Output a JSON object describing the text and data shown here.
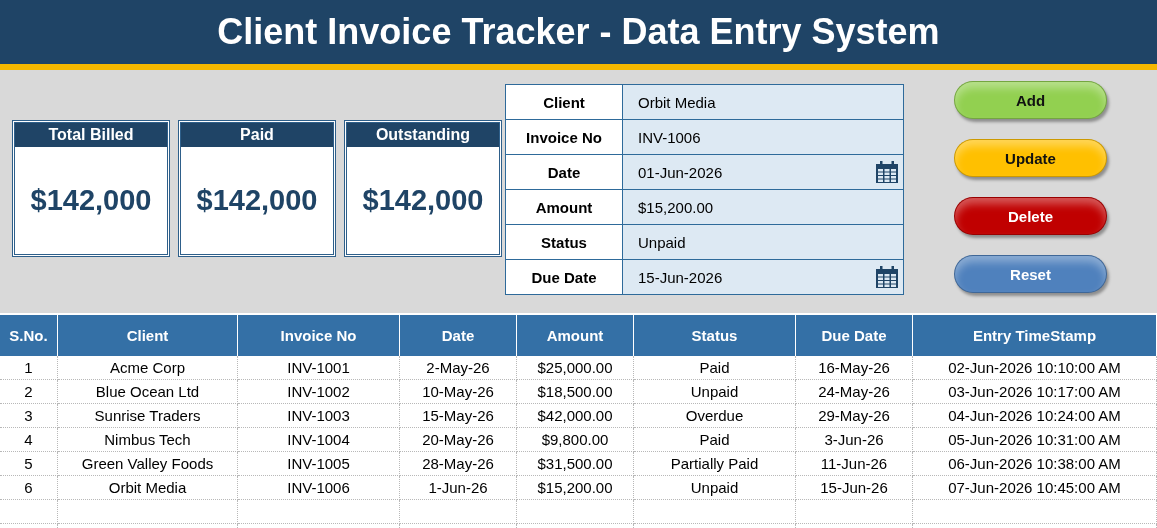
{
  "title": "Client Invoice Tracker - Data Entry System",
  "kpis": [
    {
      "label": "Total Billed",
      "value": "$142,000"
    },
    {
      "label": "Paid",
      "value": "$142,000"
    },
    {
      "label": "Outstanding",
      "value": "$142,000"
    }
  ],
  "form": [
    {
      "label": "Client",
      "value": "Orbit Media",
      "kind": "text"
    },
    {
      "label": "Invoice No",
      "value": "INV-1006",
      "kind": "text"
    },
    {
      "label": "Date",
      "value": "01-Jun-2026",
      "kind": "date"
    },
    {
      "label": "Amount",
      "value": "$15,200.00",
      "kind": "text"
    },
    {
      "label": "Status",
      "value": "Unpaid",
      "kind": "text"
    },
    {
      "label": "Due Date",
      "value": "15-Jun-2026",
      "kind": "date"
    }
  ],
  "buttons": [
    {
      "label": "Add",
      "color": "#92d050"
    },
    {
      "label": "Update",
      "color": "#ffc000"
    },
    {
      "label": "Delete",
      "color": "#c00000"
    },
    {
      "label": "Reset",
      "color": "#4f81bd"
    }
  ],
  "table": {
    "columns": [
      "S.No.",
      "Client",
      "Invoice No",
      "Date",
      "Amount",
      "Status",
      "Due Date",
      "Entry TimeStamp"
    ],
    "rows": [
      [
        "1",
        "Acme Corp",
        "INV-1001",
        "2-May-26",
        "$25,000.00",
        "Paid",
        "16-May-26",
        "02-Jun-2026 10:10:00 AM"
      ],
      [
        "2",
        "Blue Ocean Ltd",
        "INV-1002",
        "10-May-26",
        "$18,500.00",
        "Unpaid",
        "24-May-26",
        "03-Jun-2026 10:17:00 AM"
      ],
      [
        "3",
        "Sunrise Traders",
        "INV-1003",
        "15-May-26",
        "$42,000.00",
        "Overdue",
        "29-May-26",
        "04-Jun-2026 10:24:00 AM"
      ],
      [
        "4",
        "Nimbus Tech",
        "INV-1004",
        "20-May-26",
        "$9,800.00",
        "Paid",
        "3-Jun-26",
        "05-Jun-2026 10:31:00 AM"
      ],
      [
        "5",
        "Green Valley Foods",
        "INV-1005",
        "28-May-26",
        "$31,500.00",
        "Partially Paid",
        "11-Jun-26",
        "06-Jun-2026 10:38:00 AM"
      ],
      [
        "6",
        "Orbit Media",
        "INV-1006",
        "1-Jun-26",
        "$15,200.00",
        "Unpaid",
        "15-Jun-26",
        "07-Jun-2026 10:45:00 AM"
      ]
    ]
  }
}
